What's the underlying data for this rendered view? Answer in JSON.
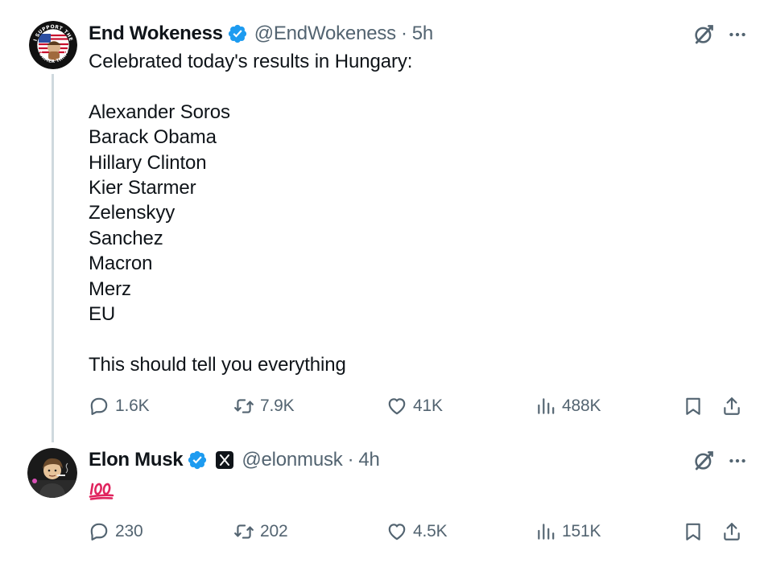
{
  "tweets": [
    {
      "display_name": "End Wokeness",
      "handle": "@EndWokeness",
      "separator": "·",
      "time": "5h",
      "lines": [
        "Celebrated today's results in Hungary:",
        "",
        "Alexander Soros",
        "Barack Obama",
        "Hillary Clinton",
        "Kier Starmer",
        "Zelenskyy",
        "Sanchez",
        "Macron",
        "Merz",
        "EU",
        "",
        "This should tell you everything"
      ],
      "replies": "1.6K",
      "reposts": "7.9K",
      "likes": "41K",
      "views": "488K",
      "avatar_text_top": "I SUPPORT THE",
      "avatar_text_bottom": "FORMER THING"
    },
    {
      "display_name": "Elon Musk",
      "handle": "@elonmusk",
      "separator": "·",
      "time": "4h",
      "emoji": "💯",
      "replies": "230",
      "reposts": "202",
      "likes": "4.5K",
      "views": "151K"
    }
  ],
  "icons": {
    "verified": "verified-badge-icon",
    "affiliate": "x-logo-badge",
    "grok": "grok-icon",
    "more": "more-icon",
    "reply": "reply-icon",
    "repost": "repost-icon",
    "like": "heart-icon",
    "views": "views-icon",
    "bookmark": "bookmark-icon",
    "share": "share-icon"
  },
  "colors": {
    "text": "#0f1419",
    "secondary": "#536471",
    "verified": "#1d9bf0",
    "thread_line": "#cfd9de",
    "hundred": "#e0245e"
  }
}
